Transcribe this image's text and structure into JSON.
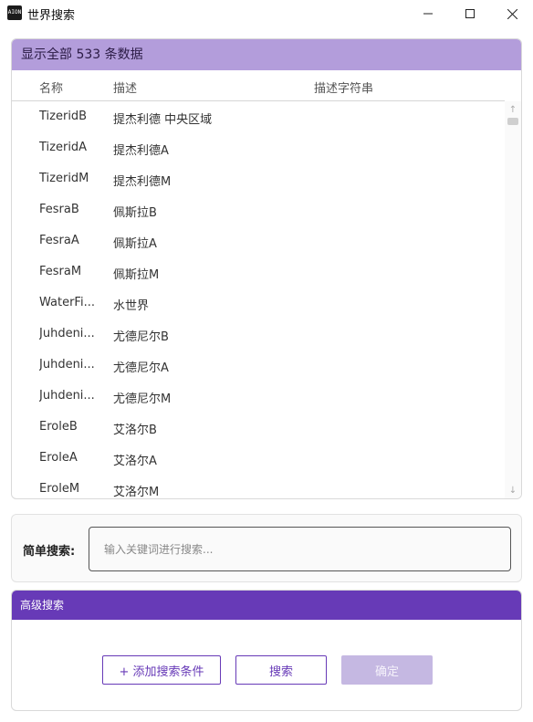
{
  "window": {
    "title": "世界搜索",
    "icon_label": "AION"
  },
  "results": {
    "header": "显示全部 533 条数据",
    "columns": [
      "名称",
      "描述",
      "描述字符串"
    ],
    "rows": [
      {
        "name": "TizeridB",
        "desc": "提杰利德 中央区域"
      },
      {
        "name": "TizeridA",
        "desc": "提杰利德A"
      },
      {
        "name": "TizeridM",
        "desc": "提杰利德M"
      },
      {
        "name": "FesraB",
        "desc": "佩斯拉B"
      },
      {
        "name": "FesraA",
        "desc": "佩斯拉A"
      },
      {
        "name": "FesraM",
        "desc": "佩斯拉M"
      },
      {
        "name": "WaterFi...",
        "desc": "水世界"
      },
      {
        "name": "Juhdeni...",
        "desc": "尤德尼尔B"
      },
      {
        "name": "Juhdeni...",
        "desc": "尤德尼尔A"
      },
      {
        "name": "Juhdeni...",
        "desc": "尤德尼尔M"
      },
      {
        "name": "EroleB",
        "desc": "艾洛尔B"
      },
      {
        "name": "EroleA",
        "desc": "艾洛尔A"
      },
      {
        "name": "EroleM",
        "desc": "艾洛尔M"
      }
    ]
  },
  "simple_search": {
    "label": "简单搜索:",
    "placeholder": "输入关键词进行搜索..."
  },
  "advanced_search": {
    "header": "高级搜索",
    "add_label": "+ 添加搜索条件",
    "search_label": "搜索",
    "ok_label": "确定"
  },
  "colors": {
    "accent": "#673ab7",
    "header_light": "#b39ddb",
    "disabled_button": "#c5b8e2"
  }
}
